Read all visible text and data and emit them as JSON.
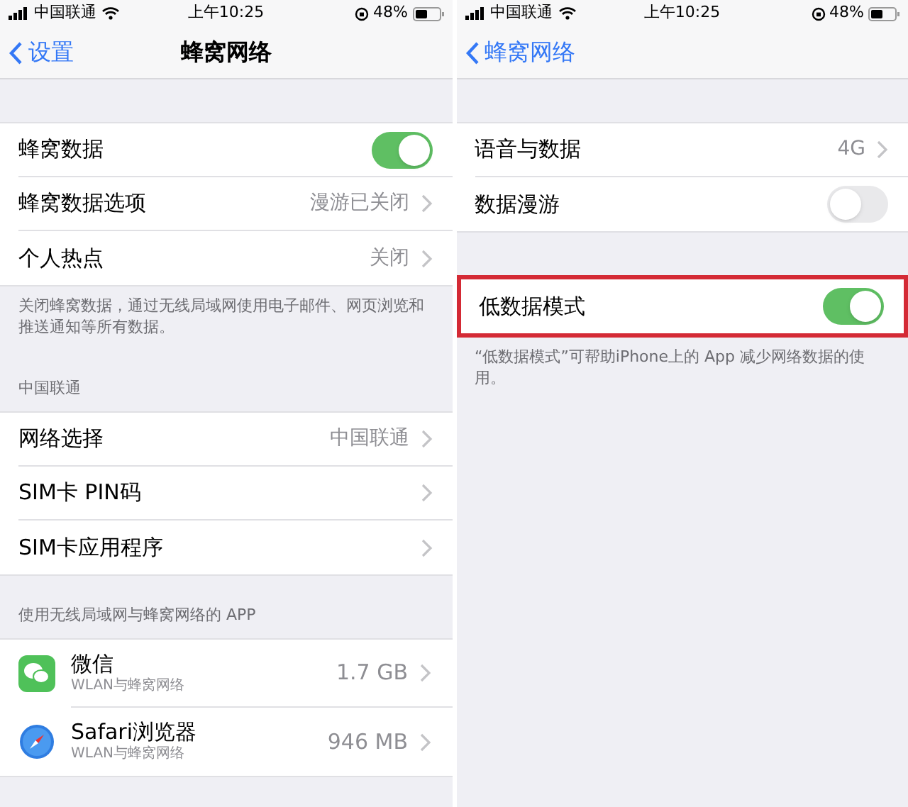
{
  "screens": [
    {
      "status_bar": {
        "carrier": "中国联通",
        "time": "上午10:25",
        "battery": "48%"
      },
      "nav": {
        "back": "设置",
        "title": "蜂窝网络"
      },
      "sections": [
        {
          "highlighted": false,
          "rows": [
            {
              "kind": "toggle",
              "label": "蜂窝数据",
              "on": true
            },
            {
              "kind": "detail",
              "label": "蜂窝数据选项",
              "value": "漫游已关闭"
            },
            {
              "kind": "detail",
              "label": "个人热点",
              "value": "关闭"
            }
          ],
          "footer": "关闭蜂窝数据，通过无线局域网使用电子邮件、网页浏览和推送通知等所有数据。"
        },
        {
          "highlighted": false,
          "header": "中国联通",
          "rows": [
            {
              "kind": "detail",
              "label": "网络选择",
              "value": "中国联通"
            },
            {
              "kind": "detail",
              "label": "SIM卡 PIN码"
            },
            {
              "kind": "detail",
              "label": "SIM卡应用程序"
            }
          ]
        },
        {
          "highlighted": false,
          "header": "使用无线局域网与蜂窝网络的 APP",
          "rows": [
            {
              "kind": "chat",
              "label": "微信",
              "subtitle": "WLAN与蜂窝网络",
              "value": "1.7 GB"
            },
            {
              "kind": "browser",
              "label": "Safari浏览器",
              "subtitle": "WLAN与蜂窝网络",
              "value": "946 MB"
            }
          ]
        }
      ]
    },
    {
      "status_bar": {
        "carrier": "中国联通",
        "time": "上午10:25",
        "battery": "48%"
      },
      "nav": {
        "back": "蜂窝网络"
      },
      "sections": [
        {
          "highlighted": false,
          "rows": [
            {
              "kind": "detail",
              "label": "语音与数据",
              "value": "4G"
            },
            {
              "kind": "toggle",
              "label": "数据漫游",
              "on": false
            }
          ]
        },
        {
          "highlighted": true,
          "rows": [
            {
              "kind": "toggle",
              "label": "低数据模式",
              "on": true
            }
          ],
          "footer": "“低数据模式”可帮助iPhone上的 App 减少网络数据的使用。"
        }
      ]
    }
  ]
}
